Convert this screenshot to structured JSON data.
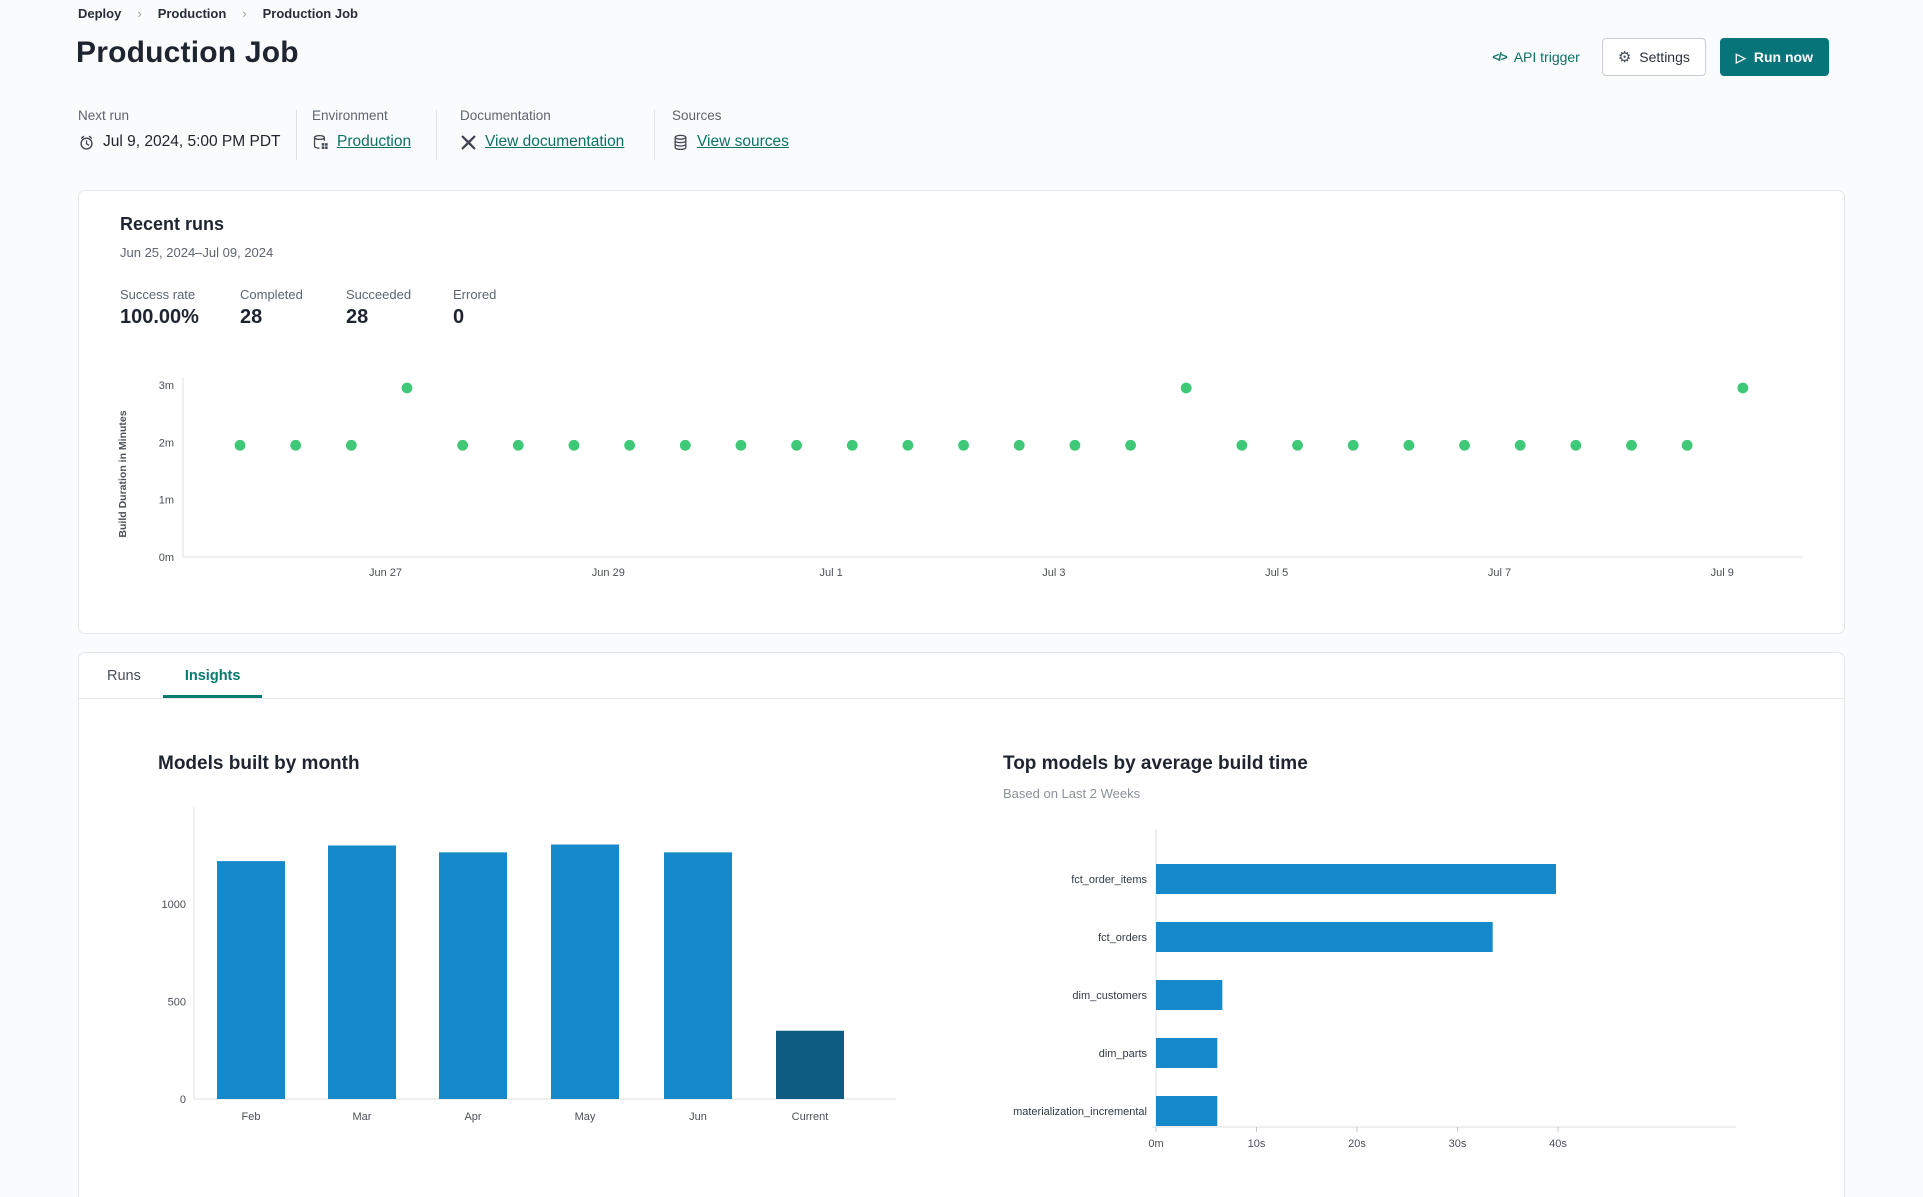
{
  "breadcrumb": {
    "separator": "›",
    "items": [
      "Deploy",
      "Production",
      "Production Job"
    ]
  },
  "header": {
    "title": "Production Job",
    "api_trigger": {
      "icon": "</>",
      "label": "API trigger"
    },
    "settings": {
      "label": "Settings"
    },
    "run_now": {
      "label": "Run now"
    }
  },
  "meta": {
    "columns": [
      {
        "label": "Next run",
        "value": "Jul 9, 2024, 5:00 PM PDT",
        "icon": "alarm-clock-icon",
        "is_link": false
      },
      {
        "label": "Environment",
        "value": "Production",
        "icon": "environment-database-icon",
        "is_link": true
      },
      {
        "label": "Documentation",
        "value": "View documentation",
        "icon": "dbt-docs-icon",
        "is_link": true
      },
      {
        "label": "Sources",
        "value": "View sources",
        "icon": "database-icon",
        "is_link": true
      }
    ]
  },
  "recent_runs": {
    "title": "Recent runs",
    "date_range": "Jun 25, 2024–Jul 09, 2024",
    "stats": [
      {
        "label": "Success rate",
        "value": "100.00%"
      },
      {
        "label": "Completed",
        "value": "28"
      },
      {
        "label": "Succeeded",
        "value": "28"
      },
      {
        "label": "Errored",
        "value": "0"
      }
    ]
  },
  "tabs": [
    {
      "label": "Runs",
      "active": false
    },
    {
      "label": "Insights",
      "active": true
    }
  ],
  "colors": {
    "accent_teal": "#0b7265",
    "button_teal": "#07747a",
    "tab_active_teal": "#087a6f",
    "bar_blue": "#1689ca",
    "bar_dark_blue": "#0e5c80",
    "dot_green": "#3fc878",
    "axis_gray": "#dcdfe2",
    "tick_text": "#4a4f57"
  },
  "chart_data": [
    {
      "id": "build-duration-scatter",
      "type": "scatter",
      "ylabel": "Build Duration in Minutes",
      "ylim": [
        0,
        3
      ],
      "yticks": [
        "0m",
        "1m",
        "2m",
        "3m"
      ],
      "xticks": [
        "Jun 27",
        "Jun 29",
        "Jul 1",
        "Jul 3",
        "Jul 5",
        "Jul 7",
        "Jul 9"
      ],
      "point_color": "#3fc878",
      "points_minutes": [
        1.95,
        1.95,
        1.95,
        2.95,
        1.95,
        1.95,
        1.95,
        1.95,
        1.95,
        1.95,
        1.95,
        1.95,
        1.95,
        1.95,
        1.95,
        1.95,
        1.95,
        2.95,
        1.95,
        1.95,
        1.95,
        1.95,
        1.95,
        1.95,
        1.95,
        1.95,
        1.95,
        2.95
      ]
    },
    {
      "id": "models-built-by-month",
      "type": "bar",
      "title": "Models built by month",
      "categories": [
        "Feb",
        "Mar",
        "Apr",
        "May",
        "Jun",
        "Current"
      ],
      "values": [
        1220,
        1300,
        1265,
        1305,
        1265,
        350
      ],
      "yticks": [
        0,
        500,
        1000
      ],
      "ylim": [
        0,
        1480
      ],
      "bar_color": "#1689ca",
      "highlight_last_color": "#0e5c80",
      "xlabel": "",
      "ylabel": ""
    },
    {
      "id": "top-models-by-average-build-time",
      "type": "bar",
      "orientation": "horizontal",
      "title": "Top models by average build time",
      "subtitle": "Based on Last 2 Weeks",
      "categories": [
        "fct_order_items",
        "fct_orders",
        "dim_customers",
        "dim_parts",
        "materialization_incremental"
      ],
      "values_seconds": [
        39.8,
        33.5,
        6.6,
        6.1,
        6.1
      ],
      "xticks": [
        "0m",
        "10s",
        "20s",
        "30s",
        "40s"
      ],
      "xlim_seconds": [
        0,
        45
      ],
      "bar_color": "#1689ca"
    }
  ]
}
